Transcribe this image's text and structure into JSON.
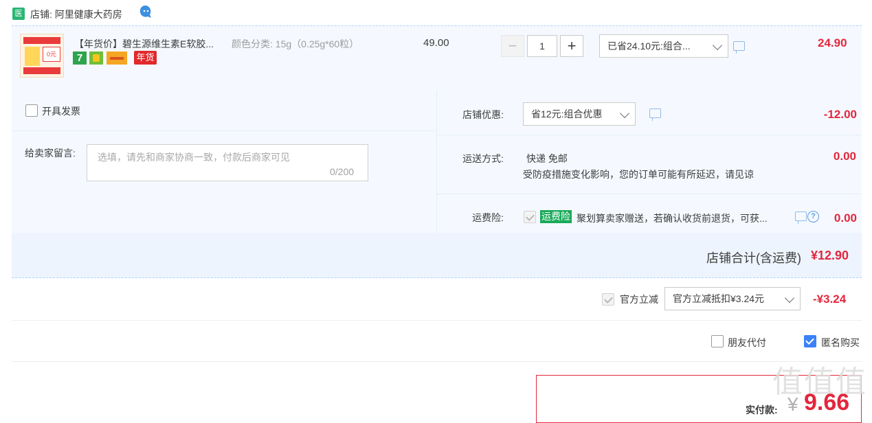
{
  "shop": {
    "icon_text": "医",
    "name": "店铺: 阿里健康大药房"
  },
  "item": {
    "title": "【年货价】碧生源维生素E软胶...",
    "sku": "颜色分类: 15g（0.25g*60粒）",
    "tag_seven": "7",
    "tag_newyear": "年货",
    "unit_price": "49.00",
    "quantity": "1",
    "minus_label": "−",
    "plus_label": "+",
    "promo_select": "已省24.10元:组合...",
    "subtotal": "24.90",
    "thumb_text": "0元"
  },
  "invoice": {
    "label": "开具发票"
  },
  "message": {
    "label": "给卖家留言:",
    "placeholder": "选填，请先和商家协商一致，付款后商家可见",
    "count": "0/200"
  },
  "shop_discount": {
    "label": "店铺优惠:",
    "select": "省12元:组合优惠",
    "amount": "-12.00"
  },
  "shipping": {
    "label": "运送方式:",
    "method": "快递 免邮",
    "note": "受防疫措施变化影响，您的订单可能有所延迟，请见谅",
    "amount": "0.00"
  },
  "insurance": {
    "label": "运费险:",
    "badge": "运费险",
    "text": "聚划算卖家赠送，若确认收货前退货，可获...",
    "help": "?",
    "amount": "0.00"
  },
  "shop_total": {
    "label": "店铺合计(含运费)",
    "amount": "¥12.90"
  },
  "official": {
    "label": "官方立减",
    "select": "官方立减抵扣¥3.24元",
    "amount": "-¥3.24"
  },
  "options": {
    "friend_pay": "朋友代付",
    "anonymous": "匿名购买"
  },
  "payment": {
    "label": "实付款:",
    "currency": "¥",
    "amount": "9.66"
  },
  "watermark": {
    "text": "值值值",
    "url": "zhi...com"
  },
  "colors": {
    "accent_red": "#e4263c",
    "row_bg": "#f5f9ff",
    "badge_green": "#1aaa5a",
    "checkbox_blue": "#3b82f6"
  }
}
